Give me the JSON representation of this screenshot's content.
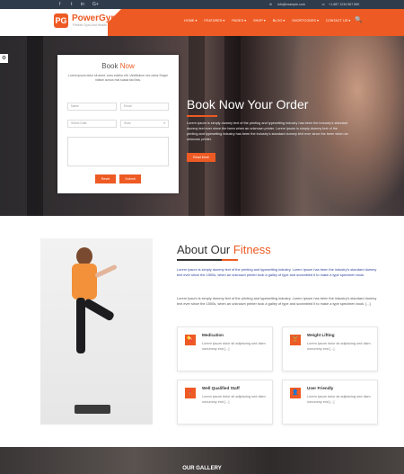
{
  "topbar": {
    "social": [
      "f",
      "t",
      "in",
      "G+"
    ],
    "email": "info@example.com",
    "phone": "+1-987 1234 567 890"
  },
  "header": {
    "logo_mark": "PG",
    "brand": "PowerGym",
    "tagline": "Fitness Gym And Health",
    "nav": [
      "HOME ▾",
      "FEATURES ▾",
      "PAGES ▾",
      "SHOP ▾",
      "BLOG ▾",
      "SHORTCODES ▾",
      "CONTACT US ▾"
    ],
    "search_icon": "🔍"
  },
  "booking_form": {
    "title_a": "Book",
    "title_b": "Now",
    "description": "Lorem ipsum dolor sit amet, cons ectetur elit. Vestibulum nec odios Suspe ndisse cursus mal suada faci lisis.",
    "name_placeholder": "Name",
    "email_placeholder": "Email",
    "date_placeholder": "Select Date",
    "slot_placeholder": "Slots",
    "reset_label": "Reset",
    "submit_label": "Submit"
  },
  "hero": {
    "title": "Book Now Your Order",
    "text": "Lorem ipsum is simply dummy text of the printing and typesetting industry has been the industry's standard dummy text ever since the been when an unknown printer. Lorem ipsum is simply dummy text of the printing and typesetting industry has been the industry's standard dummy text ever since the been when an unknown printer.",
    "button_label": "Read More"
  },
  "about": {
    "title_a": "About Our",
    "title_b": "Fitness",
    "p1": "Lorem Ipsum is simply dummy text of the printing and typesetting industry. Lorem Ipsum has been the industry's standard dummy text ever since the 1500s, when an unknown printer took a galley of type and scrambled it to make a type specimen book.",
    "p2": "Lorem Ipsum is simply dummy text of the printing and typesetting industry. Lorem Ipsum has been the industry's standard dummy text ever since the 1500s, when an unknown printer took a galley of type and scrambled it to make a type specimen book. [...]",
    "cards": [
      {
        "icon": "medication-icon",
        "glyph": "💊",
        "title": "Medication",
        "text": "Lorem ipsum dolor sit adipiscing sed diam nonummy end [...]"
      },
      {
        "icon": "weight-lifting-icon",
        "glyph": "🏋",
        "title": "Weight Lifting",
        "text": "Lorem ipsum dolor sit adipiscing sed diam nonummy end [...]"
      },
      {
        "icon": "location-icon",
        "glyph": "📍",
        "title": "Well Qualified Staff",
        "text": "Lorem ipsum dolor sit adipiscing sed diam nonummy end [...]"
      },
      {
        "icon": "user-icon",
        "glyph": "👤",
        "title": "User Friendly",
        "text": "Lorem ipsum dolor sit adipiscing sed diam nonummy end [...]"
      }
    ]
  },
  "gallery": {
    "title": "OUR GALLERY"
  },
  "colors": {
    "accent": "#ee5a23",
    "topbar": "#2f3c4c"
  }
}
